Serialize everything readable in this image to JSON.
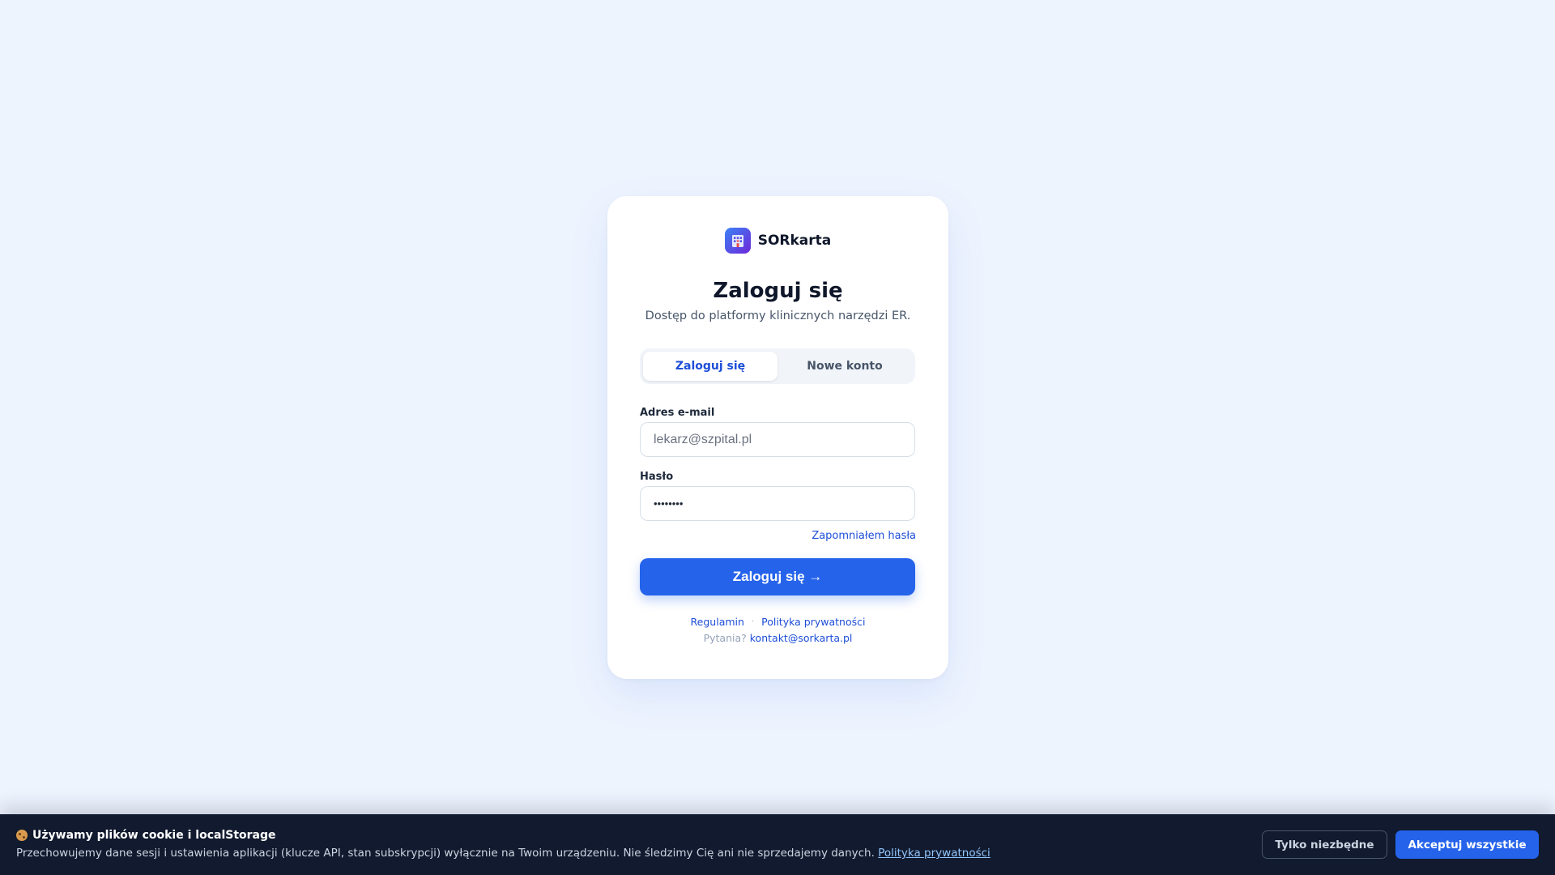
{
  "brand": {
    "name": "SORkarta",
    "icon": "hospital-icon"
  },
  "login": {
    "title": "Zaloguj się",
    "subtitle": "Dostęp do platformy klinicznych narzędzi ER.",
    "tabs": [
      {
        "label": "Zaloguj się",
        "active": true
      },
      {
        "label": "Nowe konto",
        "active": false
      }
    ],
    "email": {
      "label": "Adres e-mail",
      "placeholder": "lekarz@szpital.pl",
      "value": ""
    },
    "password": {
      "label": "Hasło",
      "value": "••••••••"
    },
    "forgot_label": "Zapomniałem hasła",
    "submit_label": "Zaloguj się →",
    "links": {
      "terms": "Regulamin",
      "separator": "·",
      "privacy": "Polityka prywatności"
    },
    "contact": {
      "prefix": "Pytania?",
      "email": "kontakt@sorkarta.pl"
    }
  },
  "cookie_banner": {
    "icon": "cookie-icon",
    "title": "Używamy plików cookie i localStorage",
    "text": "Przechowujemy dane sesji i ustawienia aplikacji (klucze API, stan subskrypcji) wyłącznie na Twoim urządzeniu. Nie śledzimy Cię ani nie sprzedajemy danych.",
    "link": "Polityka prywatności",
    "btn_necessary": "Tylko niezbędne",
    "btn_accept": "Akceptuj wszystkie"
  },
  "colors": {
    "background": "#eef4fe",
    "accent": "#2563eb",
    "banner": "#111a2e"
  }
}
